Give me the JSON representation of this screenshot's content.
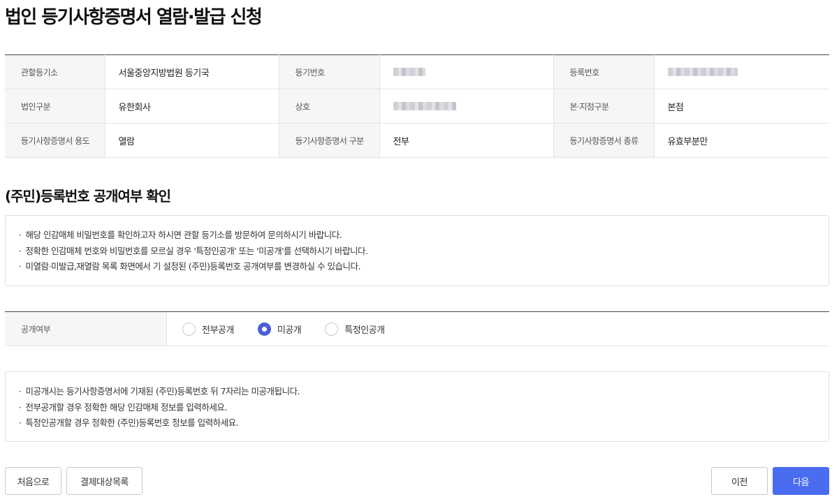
{
  "page": {
    "title": "법인 등기사항증명서 열람·발급 신청"
  },
  "info": {
    "rows": [
      [
        {
          "label": "관할등기소",
          "value": "서울중앙지방법원 등기국",
          "masked": false
        },
        {
          "label": "등기번호",
          "value": "",
          "masked": true,
          "mask_width": 46
        },
        {
          "label": "등록번호",
          "value": "",
          "masked": true,
          "mask_width": 100
        }
      ],
      [
        {
          "label": "법인구분",
          "value": "유한회사",
          "masked": false
        },
        {
          "label": "상호",
          "value": "",
          "masked": true,
          "mask_width": 90
        },
        {
          "label": "본·지점구분",
          "value": "본점",
          "masked": false
        }
      ],
      [
        {
          "label": "등기사항증명서 용도",
          "value": "열람",
          "masked": false
        },
        {
          "label": "등기사항증명서 구분",
          "value": "전부",
          "masked": false
        },
        {
          "label": "등기사항증명서 종류",
          "value": "유효부분만",
          "masked": false
        }
      ]
    ]
  },
  "section": {
    "title": "(주민)등록번호 공개여부 확인"
  },
  "notice1": {
    "items": [
      "해당 인감매체 비밀번호를 확인하고자 하시면 관할 등기소를 방문하여 문의하시기 바랍니다.",
      "정확한 인감매체 번호와 비밀번호를 모르실 경우 '특정인공개' 또는 '미공개'를 선택하시기 바랍니다.",
      "미열람·미발급,재열람 목록 화면에서 기 설정된 (주민)등록번호 공개여부를 변경하실 수 있습니다."
    ]
  },
  "disclosure": {
    "label": "공개여부",
    "options": [
      {
        "label": "전부공개",
        "checked": false
      },
      {
        "label": "미공개",
        "checked": true
      },
      {
        "label": "특정인공개",
        "checked": false
      }
    ]
  },
  "notice2": {
    "items": [
      "미공개시는 등기사항증명서에 기재된 (주민)등록번호 뒤 7자리는 미공개됩니다.",
      "전부공개할 경우 정확한 해당 인감매체 정보를 입력하세요.",
      "특정인공개할 경우 정확한 (주민)등록번호 정보를 입력하세요."
    ]
  },
  "buttons": {
    "home": "처음으로",
    "payment_list": "결제대상목록",
    "prev": "이전",
    "next": "다음"
  },
  "colors": {
    "primary": "#4a6cf0",
    "radio_checked": "#4a5fd6"
  }
}
